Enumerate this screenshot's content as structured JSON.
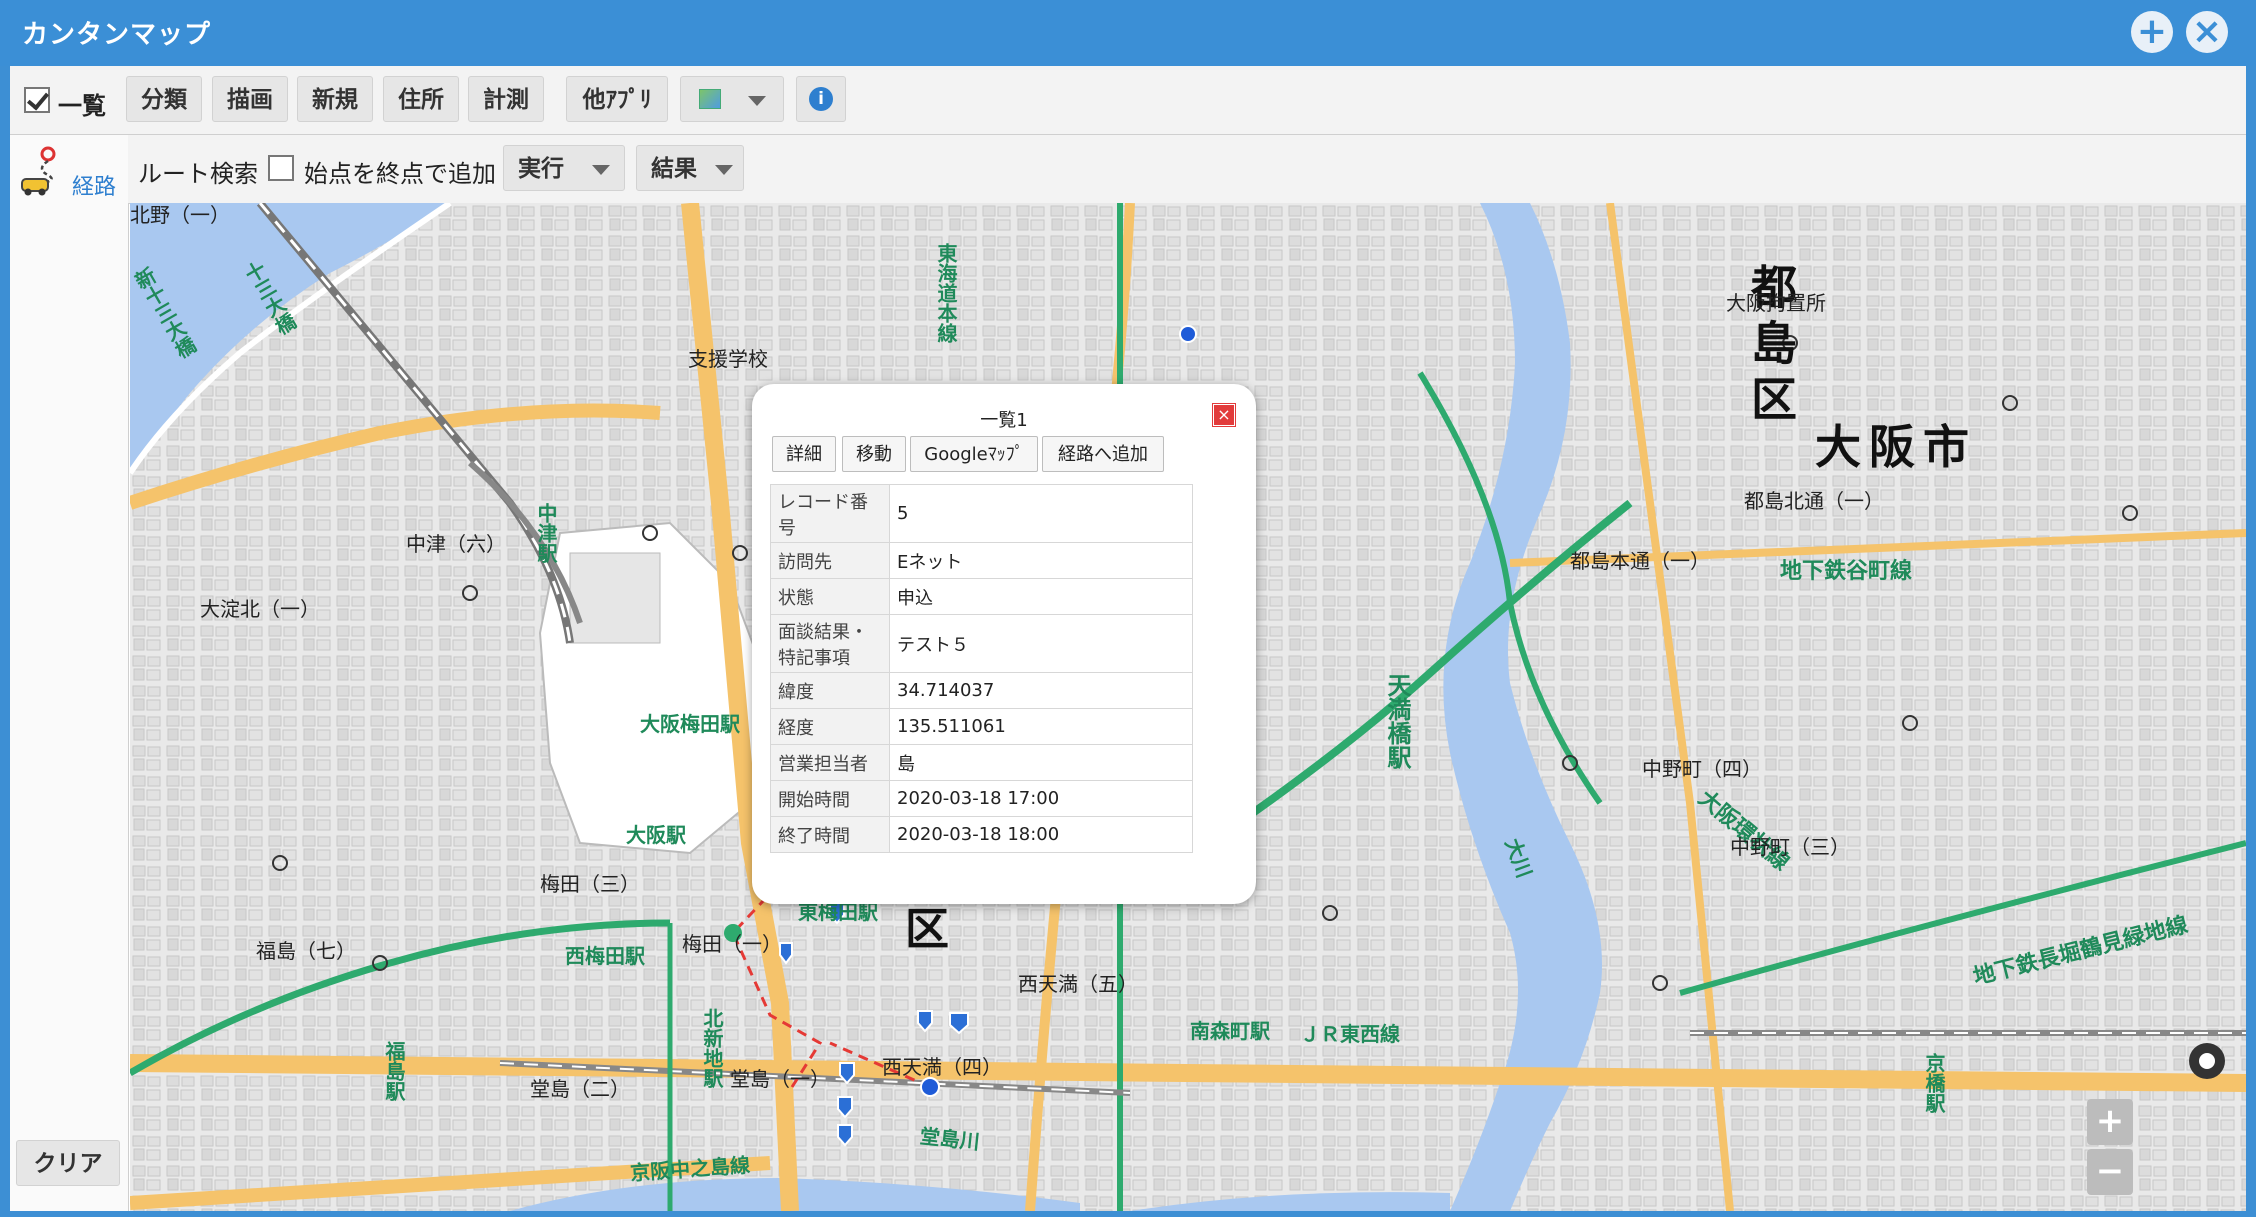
{
  "window": {
    "title": "カンタンマップ",
    "add_icon": "plus-circle-icon",
    "close_icon": "close-circle-icon"
  },
  "toolbar": {
    "list_checkbox_label": "一覧",
    "list_checked": true,
    "buttons": [
      "分類",
      "描画",
      "新規",
      "住所",
      "計測",
      "他ｱﾌﾟﾘ"
    ],
    "layer_icon": "map-layer-icon",
    "info_icon": "info-icon"
  },
  "route": {
    "side_label": "経路",
    "side_icon": "route-car-icon",
    "search_label": "ルート検索",
    "start_as_end_label": "始点を終点で追加",
    "start_as_end_checked": false,
    "execute_label": "実行",
    "result_label": "結果",
    "clear_label": "クリア"
  },
  "popup": {
    "title": "一覧1",
    "buttons": [
      "詳細",
      "移動",
      "Googleﾏｯﾌﾟ",
      "経路へ追加"
    ],
    "rows": [
      {
        "key": "レコード番号",
        "value": "5"
      },
      {
        "key": "訪問先",
        "value": "Eネット"
      },
      {
        "key": "状態",
        "value": "申込"
      },
      {
        "key": "面談結果・特記事項",
        "value": "テスト５"
      },
      {
        "key": "緯度",
        "value": "34.714037"
      },
      {
        "key": "経度",
        "value": "135.511061"
      },
      {
        "key": "営業担当者",
        "value": "島"
      },
      {
        "key": "開始時間",
        "value": "2020-03-18 17:00"
      },
      {
        "key": "終了時間",
        "value": "2020-03-18 18:00"
      }
    ]
  },
  "map": {
    "labels": {
      "miyakojima_ku": "都島区",
      "osaka_shi": "大阪市",
      "kita_ku": "区",
      "osaka_station": "大阪駅",
      "osaka_umeda": "大阪梅田駅",
      "nishi_umeda": "西梅田駅",
      "higashi_umeda": "東梅田駅",
      "kita_shinchi": "北新地駅",
      "fukushima": "福島駅",
      "nakatsu": "中津駅",
      "temmabashi": "天満橋駅",
      "kyobashi": "京橋駅",
      "minami_morimachi": "南森町駅",
      "jr_tozai": "ＪＲ東西線",
      "keihan_nakanoshima": "京阪中之島線",
      "osaka_loop": "大阪環状線",
      "nagahori": "地下鉄長堀鶴見緑地線",
      "tanimachi": "地下鉄谷町線",
      "dojima_river": "堂島川",
      "okawa": "大川",
      "umeda_3": "梅田（三）",
      "umeda_1": "梅田（一）",
      "nishitenma_5": "西天満（五）",
      "nishitenma_4": "西天満（四）",
      "dojima_1": "堂島（一）",
      "dojima_2": "堂島（二）",
      "fukushima_7": "福島（七）",
      "nakatsu_6": "中津（六）",
      "oyodokita_1": "大淀北（一）",
      "miyakojima_kitadori": "都島北通（一）",
      "miyakojima_hondori": "都島本通（一）",
      "nakanocho_4": "中野町（四）",
      "nakanocho_3": "中野町（三）",
      "shinyodogawa": "新十三大橋",
      "juso_ohashi": "十三大橋",
      "osaka_kochisho": "大阪拘置所",
      "kitano": "北野（一）",
      "shiennogakko": "支援学校",
      "tokaido": "東海道本線"
    },
    "zoom_in": "+",
    "zoom_out": "−",
    "locate_icon": "locate-icon"
  }
}
